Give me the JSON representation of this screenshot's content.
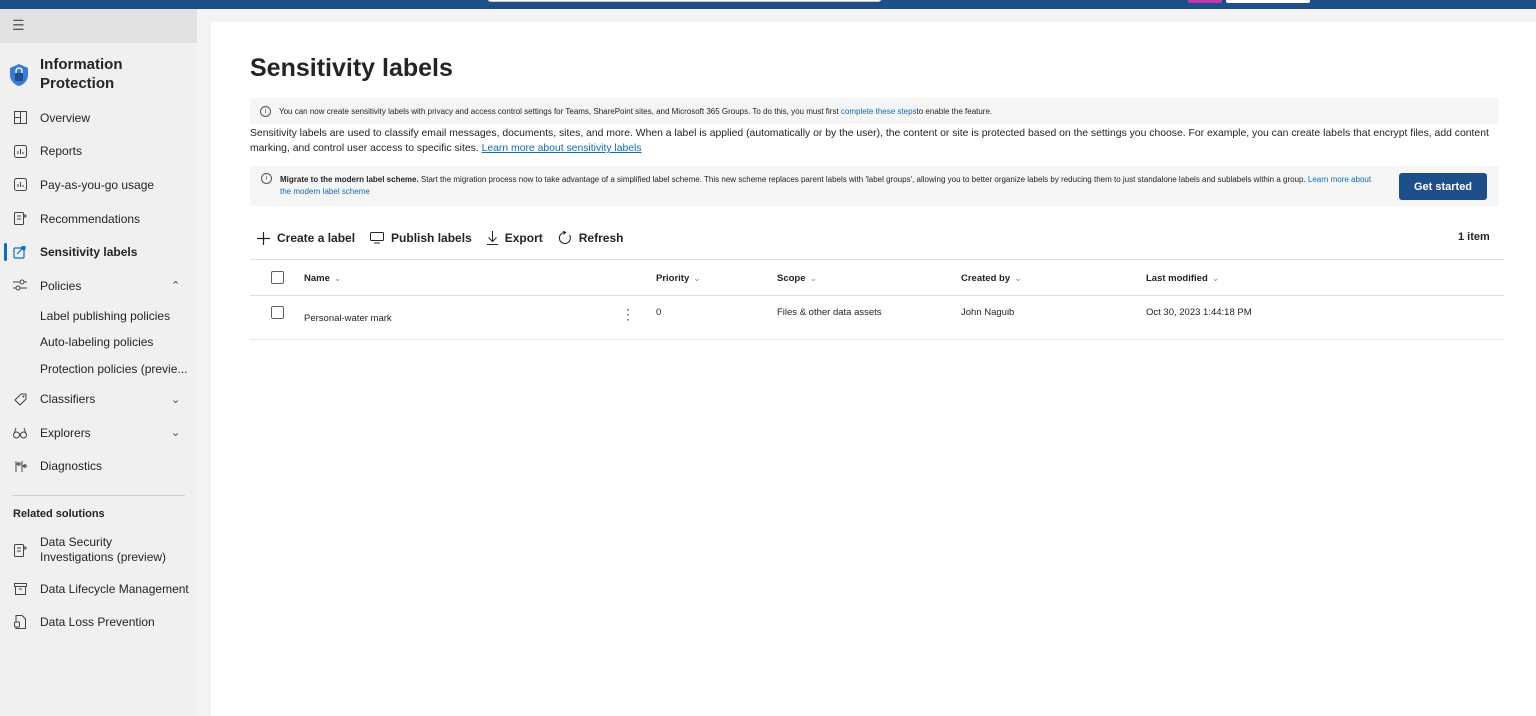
{
  "sidebar": {
    "app_title_line1": "Information",
    "app_title_line2": "Protection",
    "nav": [
      {
        "label": "Overview",
        "icon": "overview-icon"
      },
      {
        "label": "Reports",
        "icon": "reports-icon"
      },
      {
        "label": "Pay-as-you-go usage",
        "icon": "usage-icon"
      },
      {
        "label": "Recommendations",
        "icon": "recommendations-icon"
      },
      {
        "label": "Sensitivity labels",
        "icon": "sensitivity-labels-icon"
      },
      {
        "label": "Policies",
        "icon": "policies-icon"
      }
    ],
    "policies_sub": [
      "Label publishing policies",
      "Auto-labeling policies",
      "Protection policies (previe..."
    ],
    "nav2": [
      {
        "label": "Classifiers",
        "icon": "tag-icon"
      },
      {
        "label": "Explorers",
        "icon": "binoculars-icon"
      },
      {
        "label": "Diagnostics",
        "icon": "diagnostics-icon"
      }
    ],
    "related_title": "Related solutions",
    "related": [
      {
        "label_line1": "Data Security",
        "label_line2": "Investigations (preview)"
      },
      {
        "label": "Data Lifecycle Management"
      },
      {
        "label": "Data Loss Prevention"
      }
    ]
  },
  "main": {
    "title": "Sensitivity labels",
    "info_text": "You can now create sensitivity labels with privacy and access control settings for Teams, SharePoint sites, and Microsoft 365 Groups. To do this, you must first ",
    "info_link": "complete these steps",
    "info_text_end": " to enable the feature.",
    "desc_text": "Sensitivity labels are used to classify email messages, documents, sites, and more. When a label is applied (automatically or by the user), the content or site is protected based on the settings you choose. For example, you can create labels that encrypt files, add content marking, and control user access to specific sites. ",
    "desc_link": "Learn more about sensitivity labels",
    "migrate_bold": "Migrate to the modern label scheme.",
    "migrate_text": " Start the migration process now to take advantage of a simplified label scheme. This new scheme replaces parent labels with 'label groups', allowing you to better organize labels by reducing them to just standalone labels and sublabels within a group. ",
    "migrate_link": "Learn more about the modern label scheme",
    "get_started": "Get started",
    "toolbar": {
      "create": "Create a label",
      "publish": "Publish labels",
      "export": "Export",
      "refresh": "Refresh"
    },
    "item_count": "1 item",
    "table": {
      "headers": [
        "Name",
        "Priority",
        "Scope",
        "Created by",
        "Last modified"
      ],
      "rows": [
        [
          "Personal-water mark",
          "0",
          "Files & other data assets",
          "John Naguib",
          "Oct 30, 2023 1:44:18 PM"
        ]
      ]
    }
  },
  "colors": {
    "accent": "#0f6cbd",
    "topbar": "#1f4f8b",
    "button": "#1f4f8b"
  }
}
